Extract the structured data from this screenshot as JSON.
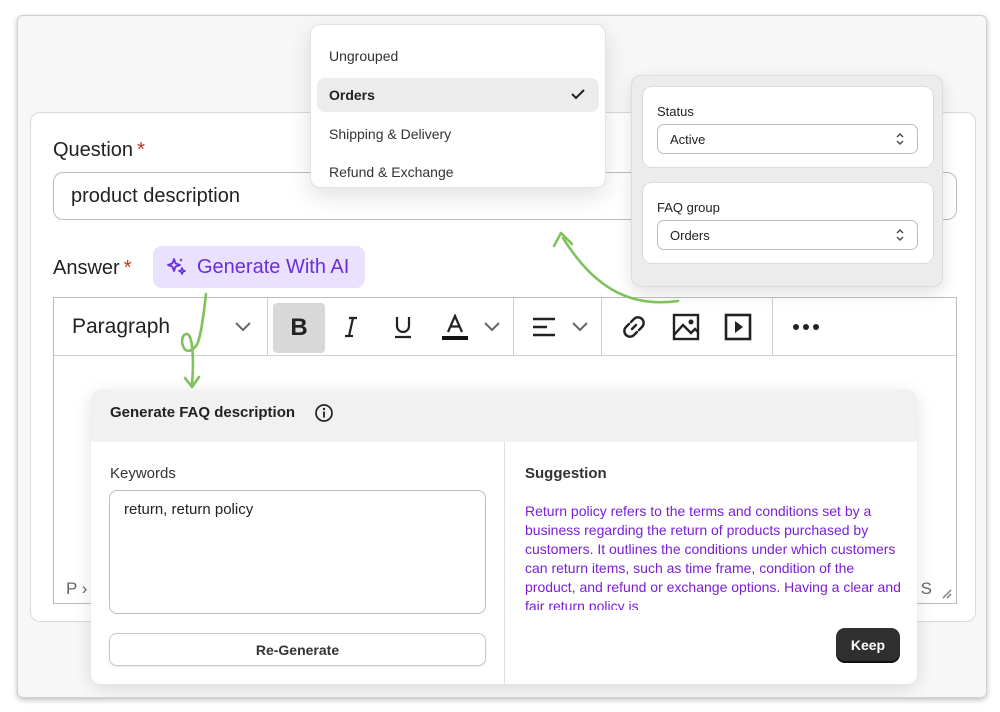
{
  "question": {
    "label": "Question",
    "required_mark": "*",
    "value": "product description"
  },
  "answer": {
    "label": "Answer",
    "required_mark": "*",
    "generate_button": "Generate With AI"
  },
  "editor": {
    "block_format": "Paragraph",
    "bold_label": "B",
    "status_path": "P ›",
    "status_right": "S"
  },
  "generate_panel": {
    "title": "Generate FAQ description",
    "keywords_label": "Keywords",
    "keywords_value": "return, return policy",
    "regenerate_label": "Re-Generate",
    "suggestion_label": "Suggestion",
    "suggestion_text": "Return policy refers to the terms and conditions set by a business regarding the return of products purchased by customers. It outlines the conditions under which customers can return items, such as time frame, condition of the product, and refund or exchange options. Having a clear and fair return policy is",
    "keep_label": "Keep",
    "suggestion_color": "#7a1fd6"
  },
  "group_dropdown": {
    "items": [
      "Ungrouped",
      "Orders",
      "Shipping & Delivery",
      "Refund & Exchange"
    ],
    "selected": "Orders"
  },
  "side_panel": {
    "status_label": "Status",
    "status_value": "Active",
    "faq_group_label": "FAQ group",
    "faq_group_value": "Orders"
  },
  "colors": {
    "accent_purple": "#6b2de0",
    "ai_button_bg": "#e9e1fd",
    "arrow_green": "#7fc15a",
    "required_red": "#c0311f"
  }
}
